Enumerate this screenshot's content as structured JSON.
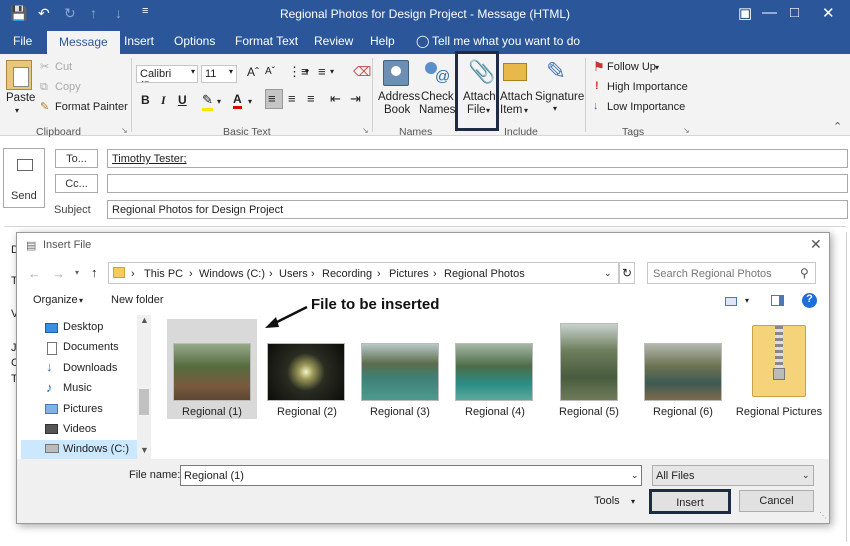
{
  "window": {
    "title": "Regional Photos for Design Project  -  Message (HTML)"
  },
  "tabs": [
    "File",
    "Message",
    "Insert",
    "Options",
    "Format Text",
    "Review",
    "Help"
  ],
  "tell_me": "Tell me what you want to do",
  "ribbon": {
    "clipboard": {
      "paste": "Paste",
      "cut": "Cut",
      "copy": "Copy",
      "format_painter": "Format Painter",
      "label": "Clipboard"
    },
    "basic_text": {
      "font": "Calibri (Boc",
      "size": "11",
      "label": "Basic Text",
      "bold": "B",
      "italic": "I",
      "underline": "U",
      "font_color_glyph": "A"
    },
    "names": {
      "address_book_1": "Address",
      "address_book_2": "Book",
      "check_names_1": "Check",
      "check_names_2": "Names",
      "label": "Names"
    },
    "include": {
      "attach_file_1": "Attach",
      "attach_file_2": "File",
      "attach_item_1": "Attach",
      "attach_item_2": "Item",
      "signature": "Signature",
      "label": "Include"
    },
    "tags": {
      "follow_up": "Follow Up",
      "high": "High Importance",
      "low": "Low Importance",
      "label": "Tags"
    }
  },
  "compose": {
    "send": "Send",
    "to_btn": "To...",
    "cc_btn": "Cc...",
    "subject_label": "Subject",
    "to_value": "Timothy Tester;",
    "subject_value": "Regional Photos for Design Project",
    "body_letters": [
      "D",
      "T",
      "V",
      "J",
      "C",
      "T"
    ]
  },
  "dialog": {
    "title": "Insert File",
    "breadcrumb": [
      "This PC",
      "Windows (C:)",
      "Users",
      "Recording",
      "Pictures",
      "Regional Photos"
    ],
    "search_placeholder": "Search Regional Photos",
    "organize": "Organize",
    "new_folder": "New folder",
    "nav": [
      "Desktop",
      "Documents",
      "Downloads",
      "Music",
      "Pictures",
      "Videos",
      "Windows (C:)"
    ],
    "files": [
      "Regional (1)",
      "Regional (2)",
      "Regional (3)",
      "Regional (4)",
      "Regional (5)",
      "Regional (6)",
      "Regional Pictures"
    ],
    "filename_label": "File name:",
    "filename_value": "Regional (1)",
    "filetype": "All Files",
    "tools": "Tools",
    "insert": "Insert",
    "cancel": "Cancel"
  },
  "annotation": "File to be inserted",
  "colors": {
    "brand": "#2b579a",
    "highlight_box": "#1f2a44",
    "selection": "#cce8ff"
  }
}
